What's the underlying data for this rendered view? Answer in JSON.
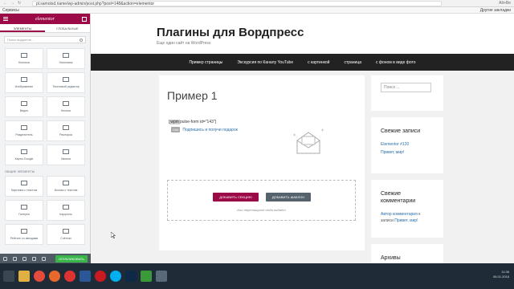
{
  "browser": {
    "url": "pl.samotsd.name/wp-admin/post.php?post=148&action=elementor",
    "bookmarks": "Сервисы",
    "other_bookmarks": "Другие закладки",
    "extensions": "Alt+Be"
  },
  "editor": {
    "logo": "elementor",
    "tabs": [
      "ЭЛЕМЕНТЫ",
      "ГЛОБАЛЬНЫЕ"
    ],
    "search_placeholder": "Поиск виджетов...",
    "widgets_top": [
      "Колонки",
      "Заголовок",
      "Изображение",
      "Текстовый редактор",
      "Видео",
      "Кнопка",
      "Разделитель",
      "Распорка",
      "Карты Google",
      "Иконка"
    ],
    "section_general": "ОБЩИЕ ЭЛЕМЕНТЫ",
    "widgets_general": [
      "Картинка с текстом",
      "Иконка с текстом",
      "Галерея",
      "Карусель",
      "Рейтинг со звездами",
      "Счётчик"
    ],
    "update_button": "ОПУБЛИКОВАТЬ"
  },
  "site": {
    "title": "Плагины для Вордпресс",
    "tagline": "Еще один сайт на WordPress",
    "nav": [
      "Пример страницы",
      "Экскурсия по Каналу YouTube",
      "с картинкой",
      "страница",
      "с фоном в виде фото"
    ]
  },
  "post": {
    "title": "Пример 1",
    "shortcode_prefix": "[",
    "shortcode_highlight": "wpm",
    "shortcode_rest": "pulse-form id=\"143\"]",
    "subscribe_badge": "Link",
    "subscribe_link": "Подпишись и получи подарок",
    "add_section": "ДОБАВИТЬ СЕКЦИЮ",
    "add_template": "ДОБАВИТЬ ШАБЛОН",
    "drop_hint": "Или перетащите сюда виджет"
  },
  "sidebar": {
    "search_placeholder": "Поиск ...",
    "recent_title": "Свежие записи",
    "recent_posts": [
      "Elementor #120",
      "Привет, мир!"
    ],
    "comments_title": "Свежие комментарии",
    "comment_author": "Автор комментария",
    "comment_to": "к записи",
    "comment_post": "Привет, мир!",
    "archive_title": "Архивы"
  },
  "taskbar": {
    "time": "11:36",
    "date": "06.01.2018",
    "icons": [
      "start",
      "files",
      "chrome",
      "firefox",
      "yandex",
      "word",
      "opera",
      "skype",
      "photoshop",
      "camtasia",
      "app"
    ]
  },
  "colors": {
    "accent": "#9b0a46",
    "dark_nav": "#222222",
    "link": "#2c6fa8",
    "taskbar": "#1f2b36",
    "update_green": "#39b54a"
  }
}
